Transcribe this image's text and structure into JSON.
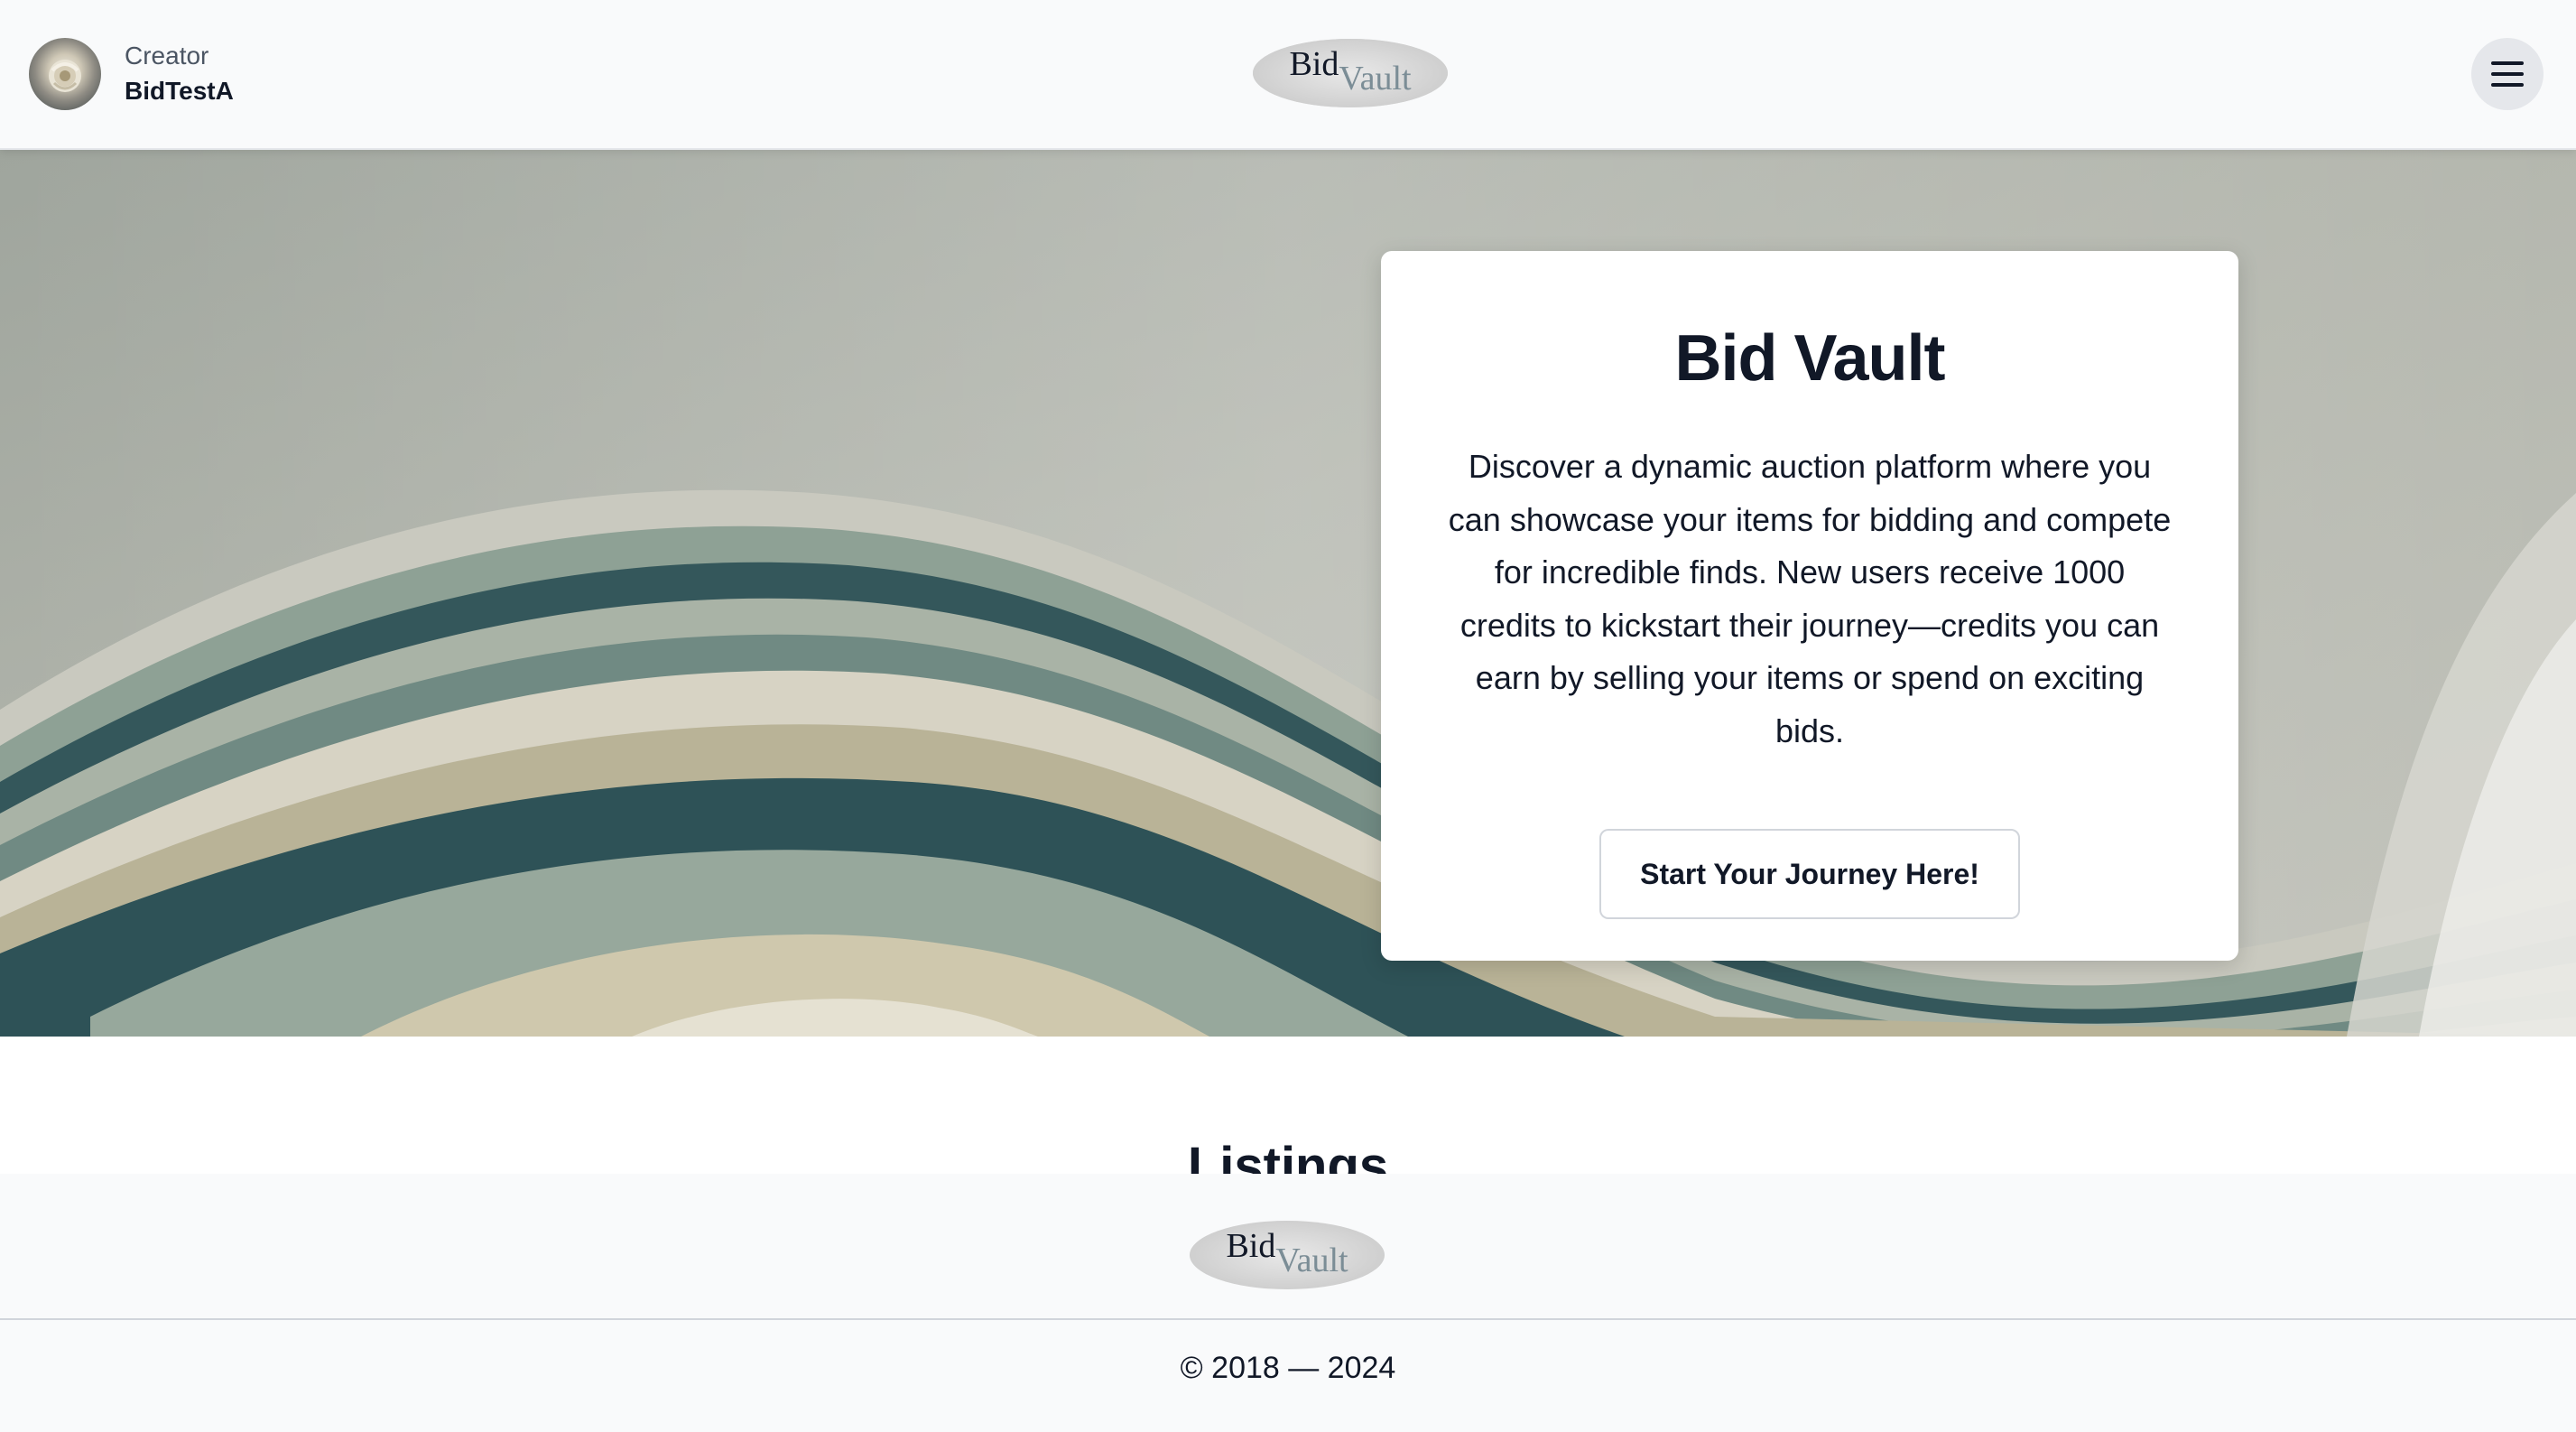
{
  "header": {
    "user": {
      "role": "Creator",
      "name": "BidTestA"
    },
    "logo": {
      "bid": "Bid",
      "vault": "Vault"
    },
    "menu_icon": "hamburger-icon"
  },
  "hero": {
    "title": "Bid Vault",
    "description": "Discover a dynamic auction platform where you can showcase your items for bidding and compete for incredible finds. New users receive 1000 credits to kickstart their journey—credits you can earn by selling your items or spend on exciting bids.",
    "cta_label": "Start Your Journey Here!"
  },
  "main": {
    "listings_title": "Listings"
  },
  "footer": {
    "logo": {
      "bid": "Bid",
      "vault": "Vault"
    },
    "copyright": "© 2018 — 2024"
  },
  "colors": {
    "header_bg": "#f9fafb",
    "text_primary": "#111827",
    "logo_vault": "#7b8d96",
    "hero_teal": "#34575b",
    "hero_sage": "#8fa196",
    "hero_sand": "#b8b39a"
  }
}
